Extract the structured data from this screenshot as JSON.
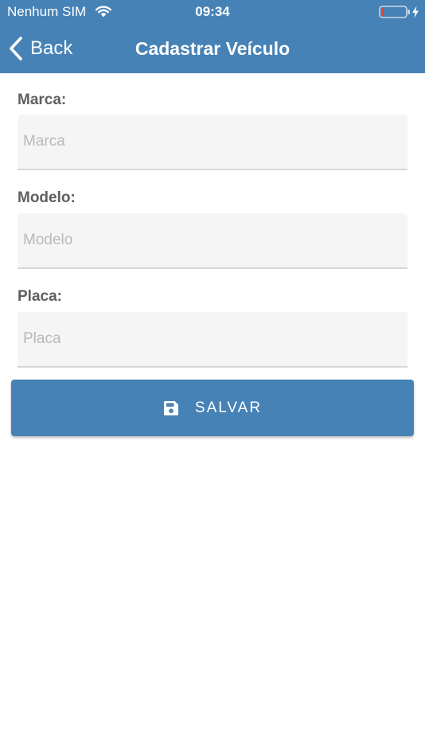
{
  "status_bar": {
    "carrier": "Nenhum SIM",
    "time": "09:34",
    "wifi_icon": "wifi-icon",
    "battery_icon": "battery-low-icon",
    "charging_icon": "bolt-icon"
  },
  "nav": {
    "back_label": "Back",
    "back_icon": "chevron-left-icon",
    "title": "Cadastrar Veículo"
  },
  "form": {
    "marca": {
      "label": "Marca:",
      "placeholder": "Marca",
      "value": ""
    },
    "modelo": {
      "label": "Modelo:",
      "placeholder": "Modelo",
      "value": ""
    },
    "placa": {
      "label": "Placa:",
      "placeholder": "Placa",
      "value": ""
    }
  },
  "actions": {
    "save_label": "SALVAR",
    "save_icon": "floppy-disk-icon"
  },
  "colors": {
    "primary": "#4682b6",
    "label": "#5f5f5f",
    "input_background": "#f5f5f5",
    "placeholder": "#b9b9b9",
    "battery_low": "#e8413a"
  }
}
